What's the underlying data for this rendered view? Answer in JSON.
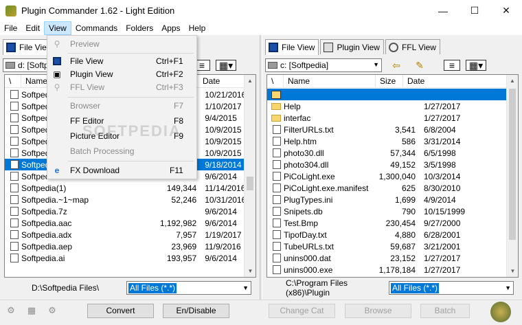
{
  "window": {
    "title": "Plugin Commander 1.62 - Light Edition",
    "minimize": "—",
    "maximize": "☐",
    "close": "✕"
  },
  "menu": [
    "File",
    "Edit",
    "View",
    "Commands",
    "Folders",
    "Apps",
    "Help"
  ],
  "view_menu": {
    "items": [
      {
        "label": "Preview",
        "shortcut": "",
        "enabled": false,
        "icon": "preview-icon"
      },
      {
        "label": "File View",
        "shortcut": "Ctrl+F1",
        "enabled": true,
        "icon": "file-view-icon"
      },
      {
        "label": "Plugin View",
        "shortcut": "Ctrl+F2",
        "enabled": true,
        "icon": "plugin-view-icon"
      },
      {
        "label": "FFL View",
        "shortcut": "Ctrl+F3",
        "enabled": false,
        "icon": "ffl-view-icon"
      },
      {
        "label": "Browser",
        "shortcut": "F7",
        "enabled": false
      },
      {
        "label": "FF Editor",
        "shortcut": "F8",
        "enabled": true
      },
      {
        "label": "Picture Editor",
        "shortcut": "F9",
        "enabled": true
      },
      {
        "label": "Batch Processing",
        "shortcut": "",
        "enabled": false
      },
      {
        "label": "FX Download",
        "shortcut": "F11",
        "enabled": true,
        "icon": "ie-icon"
      }
    ]
  },
  "watermark": "SOFTPEDIA",
  "left": {
    "tabs": [
      "File View"
    ],
    "drive": "d: [Softpedia]",
    "columns": {
      "sort": "\\",
      "name": "Name",
      "date": "Date"
    },
    "rows": [
      {
        "name": "Softpedia",
        "size": "",
        "date": "10/21/2016"
      },
      {
        "name": "Softpedia",
        "size": "",
        "date": "1/10/2017"
      },
      {
        "name": "Softpedia",
        "size": "",
        "date": "9/4/2015"
      },
      {
        "name": "Softpedia",
        "size": "",
        "date": "10/9/2015"
      },
      {
        "name": "Softpedia",
        "size": "",
        "date": "10/9/2015"
      },
      {
        "name": "Softpedia",
        "size": "",
        "date": "10/9/2015"
      },
      {
        "name": "Softpedia",
        "size": "",
        "date": "9/18/2014",
        "selected": true
      },
      {
        "name": "Softpedia",
        "size": "",
        "date": "9/6/2014"
      },
      {
        "name": "Softpedia(1)",
        "size": "149,344",
        "date": "11/14/2016"
      },
      {
        "name": "Softpedia.~1~map",
        "size": "52,246",
        "date": "10/31/2016"
      },
      {
        "name": "Softpedia.7z",
        "size": "",
        "date": "9/6/2014"
      },
      {
        "name": "Softpedia.aac",
        "size": "1,192,982",
        "date": "9/6/2014"
      },
      {
        "name": "Softpedia.adx",
        "size": "7,957",
        "date": "1/19/2017"
      },
      {
        "name": "Softpedia.aep",
        "size": "23,969",
        "date": "11/9/2016"
      },
      {
        "name": "Softpedia.ai",
        "size": "193,957",
        "date": "9/6/2014"
      }
    ],
    "path": "D:\\Softpedia Files\\",
    "filter": "All Files (*.*)"
  },
  "right": {
    "tabs": [
      "File View",
      "Plugin View",
      "FFL View"
    ],
    "drive": "c: [Softpedia]",
    "columns": {
      "sort": "\\",
      "name": "Name",
      "size": "Size",
      "date": "Date"
    },
    "rows": [
      {
        "name": "",
        "size": "",
        "date": "",
        "type": "up",
        "selected": true
      },
      {
        "name": "Help",
        "size": "",
        "date": "1/27/2017",
        "type": "folder"
      },
      {
        "name": "interfac",
        "size": "",
        "date": "1/27/2017",
        "type": "folder"
      },
      {
        "name": "FilterURLs.txt",
        "size": "3,541",
        "date": "6/8/2004"
      },
      {
        "name": "Help.htm",
        "size": "586",
        "date": "3/31/2014"
      },
      {
        "name": "photo30.dll",
        "size": "57,344",
        "date": "6/5/1998"
      },
      {
        "name": "photo304.dll",
        "size": "49,152",
        "date": "3/5/1998"
      },
      {
        "name": "PiCoLight.exe",
        "size": "1,300,040",
        "date": "10/3/2014"
      },
      {
        "name": "PiCoLight.exe.manifest",
        "size": "625",
        "date": "8/30/2010"
      },
      {
        "name": "PlugTypes.ini",
        "size": "1,699",
        "date": "4/9/2014"
      },
      {
        "name": "Snipets.db",
        "size": "790",
        "date": "10/15/1999"
      },
      {
        "name": "Test.Bmp",
        "size": "230,454",
        "date": "9/27/2000"
      },
      {
        "name": "TipofDay.txt",
        "size": "4,880",
        "date": "6/28/2001"
      },
      {
        "name": "TubeURLs.txt",
        "size": "59,687",
        "date": "3/21/2001"
      },
      {
        "name": "unins000.dat",
        "size": "23,152",
        "date": "1/27/2017"
      },
      {
        "name": "unins000.exe",
        "size": "1,178,184",
        "date": "1/27/2017"
      }
    ],
    "path": "C:\\Program Files (x86)\\Plugin",
    "filter": "All Files (*.*)"
  },
  "bottom": {
    "convert": "Convert",
    "enable_disable": "En/Disable",
    "change_cat": "Change Cat",
    "browse": "Browse",
    "batch": "Batch"
  }
}
